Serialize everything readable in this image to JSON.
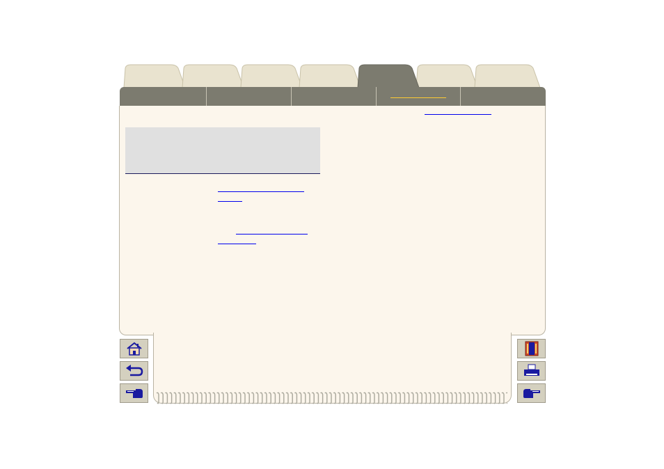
{
  "tabs": [
    {
      "id": "tab-1",
      "active": false
    },
    {
      "id": "tab-2",
      "active": false
    },
    {
      "id": "tab-3",
      "active": false
    },
    {
      "id": "tab-4",
      "active": false
    },
    {
      "id": "tab-5",
      "active": true
    },
    {
      "id": "tab-6",
      "active": false
    },
    {
      "id": "tab-7",
      "active": false
    }
  ],
  "subnav": [
    {
      "id": "subnav-1",
      "selected": false
    },
    {
      "id": "subnav-2",
      "selected": false
    },
    {
      "id": "subnav-3",
      "selected": false
    },
    {
      "id": "subnav-4",
      "selected": true
    },
    {
      "id": "subnav-5",
      "selected": false
    }
  ],
  "colors": {
    "tab_inactive": "#e9e3cf",
    "tab_active": "#7c7b6f",
    "page_background": "#fcf6ec",
    "link": "#0000ee",
    "selected_mark": "#ffcc33",
    "button": "#d4d0bf",
    "icon_blue": "#1a1aa0"
  },
  "icons": {
    "left": [
      "home-icon",
      "back-arrow-icon",
      "previous-page-hand-icon"
    ],
    "right": [
      "contents-book-icon",
      "printer-icon",
      "next-page-hand-icon"
    ]
  }
}
